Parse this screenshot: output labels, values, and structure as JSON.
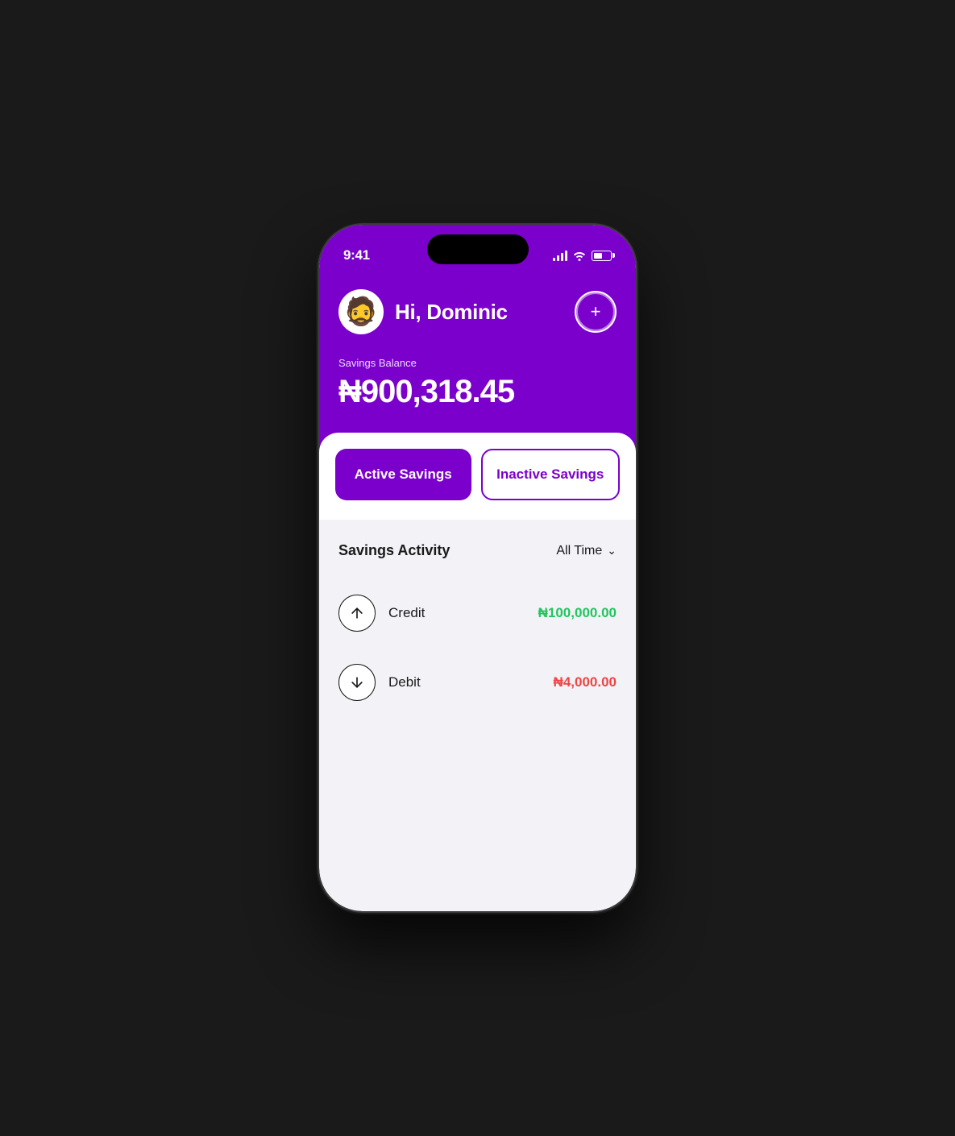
{
  "status_bar": {
    "time": "9:41",
    "signal_bars": [
      3,
      5,
      7,
      9,
      11
    ],
    "wifi": "wifi",
    "battery_level": 50
  },
  "header": {
    "greeting": "Hi, Dominic",
    "avatar_emoji": "🧔",
    "add_button_label": "+",
    "balance_label": "Savings Balance",
    "balance_amount": "₦900,318.45"
  },
  "tabs": {
    "active_label": "Active Savings",
    "inactive_label": "Inactive Savings"
  },
  "activity": {
    "title": "Savings Activity",
    "filter_label": "All Time",
    "transactions": [
      {
        "type": "credit",
        "label": "Credit",
        "amount": "₦100,000.00",
        "direction": "up"
      },
      {
        "type": "debit",
        "label": "Debit",
        "amount": "₦4,000.00",
        "direction": "down"
      }
    ]
  }
}
